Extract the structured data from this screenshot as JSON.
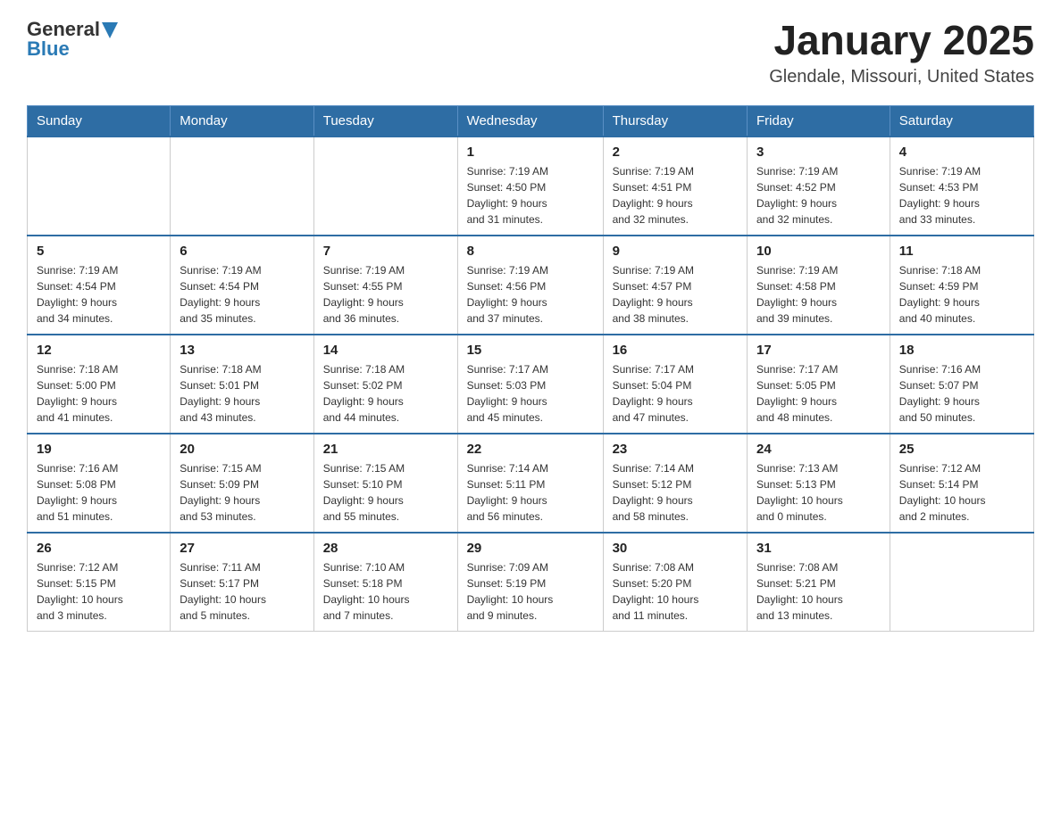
{
  "header": {
    "logo_general": "General",
    "logo_blue": "Blue",
    "month_title": "January 2025",
    "location": "Glendale, Missouri, United States"
  },
  "days_of_week": [
    "Sunday",
    "Monday",
    "Tuesday",
    "Wednesday",
    "Thursday",
    "Friday",
    "Saturday"
  ],
  "weeks": [
    [
      {
        "day": "",
        "info": ""
      },
      {
        "day": "",
        "info": ""
      },
      {
        "day": "",
        "info": ""
      },
      {
        "day": "1",
        "info": "Sunrise: 7:19 AM\nSunset: 4:50 PM\nDaylight: 9 hours\nand 31 minutes."
      },
      {
        "day": "2",
        "info": "Sunrise: 7:19 AM\nSunset: 4:51 PM\nDaylight: 9 hours\nand 32 minutes."
      },
      {
        "day": "3",
        "info": "Sunrise: 7:19 AM\nSunset: 4:52 PM\nDaylight: 9 hours\nand 32 minutes."
      },
      {
        "day": "4",
        "info": "Sunrise: 7:19 AM\nSunset: 4:53 PM\nDaylight: 9 hours\nand 33 minutes."
      }
    ],
    [
      {
        "day": "5",
        "info": "Sunrise: 7:19 AM\nSunset: 4:54 PM\nDaylight: 9 hours\nand 34 minutes."
      },
      {
        "day": "6",
        "info": "Sunrise: 7:19 AM\nSunset: 4:54 PM\nDaylight: 9 hours\nand 35 minutes."
      },
      {
        "day": "7",
        "info": "Sunrise: 7:19 AM\nSunset: 4:55 PM\nDaylight: 9 hours\nand 36 minutes."
      },
      {
        "day": "8",
        "info": "Sunrise: 7:19 AM\nSunset: 4:56 PM\nDaylight: 9 hours\nand 37 minutes."
      },
      {
        "day": "9",
        "info": "Sunrise: 7:19 AM\nSunset: 4:57 PM\nDaylight: 9 hours\nand 38 minutes."
      },
      {
        "day": "10",
        "info": "Sunrise: 7:19 AM\nSunset: 4:58 PM\nDaylight: 9 hours\nand 39 minutes."
      },
      {
        "day": "11",
        "info": "Sunrise: 7:18 AM\nSunset: 4:59 PM\nDaylight: 9 hours\nand 40 minutes."
      }
    ],
    [
      {
        "day": "12",
        "info": "Sunrise: 7:18 AM\nSunset: 5:00 PM\nDaylight: 9 hours\nand 41 minutes."
      },
      {
        "day": "13",
        "info": "Sunrise: 7:18 AM\nSunset: 5:01 PM\nDaylight: 9 hours\nand 43 minutes."
      },
      {
        "day": "14",
        "info": "Sunrise: 7:18 AM\nSunset: 5:02 PM\nDaylight: 9 hours\nand 44 minutes."
      },
      {
        "day": "15",
        "info": "Sunrise: 7:17 AM\nSunset: 5:03 PM\nDaylight: 9 hours\nand 45 minutes."
      },
      {
        "day": "16",
        "info": "Sunrise: 7:17 AM\nSunset: 5:04 PM\nDaylight: 9 hours\nand 47 minutes."
      },
      {
        "day": "17",
        "info": "Sunrise: 7:17 AM\nSunset: 5:05 PM\nDaylight: 9 hours\nand 48 minutes."
      },
      {
        "day": "18",
        "info": "Sunrise: 7:16 AM\nSunset: 5:07 PM\nDaylight: 9 hours\nand 50 minutes."
      }
    ],
    [
      {
        "day": "19",
        "info": "Sunrise: 7:16 AM\nSunset: 5:08 PM\nDaylight: 9 hours\nand 51 minutes."
      },
      {
        "day": "20",
        "info": "Sunrise: 7:15 AM\nSunset: 5:09 PM\nDaylight: 9 hours\nand 53 minutes."
      },
      {
        "day": "21",
        "info": "Sunrise: 7:15 AM\nSunset: 5:10 PM\nDaylight: 9 hours\nand 55 minutes."
      },
      {
        "day": "22",
        "info": "Sunrise: 7:14 AM\nSunset: 5:11 PM\nDaylight: 9 hours\nand 56 minutes."
      },
      {
        "day": "23",
        "info": "Sunrise: 7:14 AM\nSunset: 5:12 PM\nDaylight: 9 hours\nand 58 minutes."
      },
      {
        "day": "24",
        "info": "Sunrise: 7:13 AM\nSunset: 5:13 PM\nDaylight: 10 hours\nand 0 minutes."
      },
      {
        "day": "25",
        "info": "Sunrise: 7:12 AM\nSunset: 5:14 PM\nDaylight: 10 hours\nand 2 minutes."
      }
    ],
    [
      {
        "day": "26",
        "info": "Sunrise: 7:12 AM\nSunset: 5:15 PM\nDaylight: 10 hours\nand 3 minutes."
      },
      {
        "day": "27",
        "info": "Sunrise: 7:11 AM\nSunset: 5:17 PM\nDaylight: 10 hours\nand 5 minutes."
      },
      {
        "day": "28",
        "info": "Sunrise: 7:10 AM\nSunset: 5:18 PM\nDaylight: 10 hours\nand 7 minutes."
      },
      {
        "day": "29",
        "info": "Sunrise: 7:09 AM\nSunset: 5:19 PM\nDaylight: 10 hours\nand 9 minutes."
      },
      {
        "day": "30",
        "info": "Sunrise: 7:08 AM\nSunset: 5:20 PM\nDaylight: 10 hours\nand 11 minutes."
      },
      {
        "day": "31",
        "info": "Sunrise: 7:08 AM\nSunset: 5:21 PM\nDaylight: 10 hours\nand 13 minutes."
      },
      {
        "day": "",
        "info": ""
      }
    ]
  ]
}
